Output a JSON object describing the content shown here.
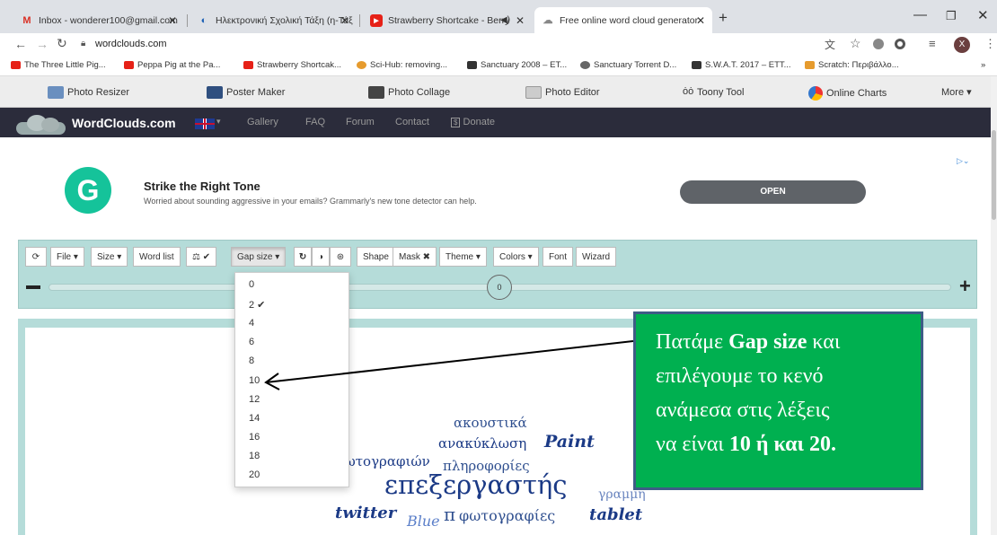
{
  "browser": {
    "tabs": [
      {
        "label": "Inbox - wonderer100@gmail.com",
        "icon": "gmail-icon"
      },
      {
        "label": "Ηλεκτρονική Σχολική Τάξη (η-Τάξ",
        "icon": "eclass-icon"
      },
      {
        "label": "Strawberry Shortcake - Berry",
        "icon": "youtube-icon"
      },
      {
        "label": "Free online word cloud generator",
        "icon": "cloud-icon"
      }
    ],
    "url": "wordclouds.com",
    "bookmarks": [
      "The Three Little Pig...",
      "Peppa Pig at the Pa...",
      "Strawberry Shortcak...",
      "Sci-Hub: removing...",
      "Sanctuary 2008 – ET...",
      "Sanctuary Torrent D...",
      "S.W.A.T. 2017 – ETT...",
      "Scratch: Περιβάλλο..."
    ],
    "profile_initial": "X"
  },
  "sitebar": {
    "items": [
      "Photo Resizer",
      "Poster Maker",
      "Photo Collage",
      "Photo Editor",
      "Toony Tool",
      "Online Charts",
      "More ▾"
    ]
  },
  "nav": {
    "brand": "WordClouds.com",
    "items": [
      "Gallery",
      "FAQ",
      "Forum",
      "Contact",
      "Donate"
    ]
  },
  "ad": {
    "title": "Strike the Right Tone",
    "text": "Worried about sounding aggressive in your emails? Grammarly's new tone detector can help.",
    "button": "OPEN"
  },
  "toolbar": {
    "buttons": [
      "File ▾",
      "Size ▾",
      "Word list",
      "Gap size ▾",
      "Shape",
      "Mask ✖",
      "Theme ▾",
      "Colors ▾",
      "Font",
      "Wizard"
    ],
    "slider_value": "0"
  },
  "dropdown": {
    "options": [
      "0",
      "2 ✔",
      "4",
      "6",
      "8",
      "10",
      "12",
      "14",
      "16",
      "18",
      "20"
    ],
    "selected": "2"
  },
  "callout": {
    "l1": "Πατάμε ",
    "b1": "Gap size",
    "l2": " και",
    "l3": "επιλέγουμε το κενό",
    "l4": "ανάμεσα στις λέξεις",
    "l5": "να είναι ",
    "b2": "10 ή και 20."
  },
  "cloud": {
    "words": [
      "ακουστικά",
      "ανακύκλωση",
      "Paint",
      "φωτογραφιών",
      "πληροφορίες",
      "επεξεργαστής",
      "γραμμη",
      "twitter",
      "Blue",
      "φωτογραφίες",
      "tablet",
      "π"
    ]
  }
}
